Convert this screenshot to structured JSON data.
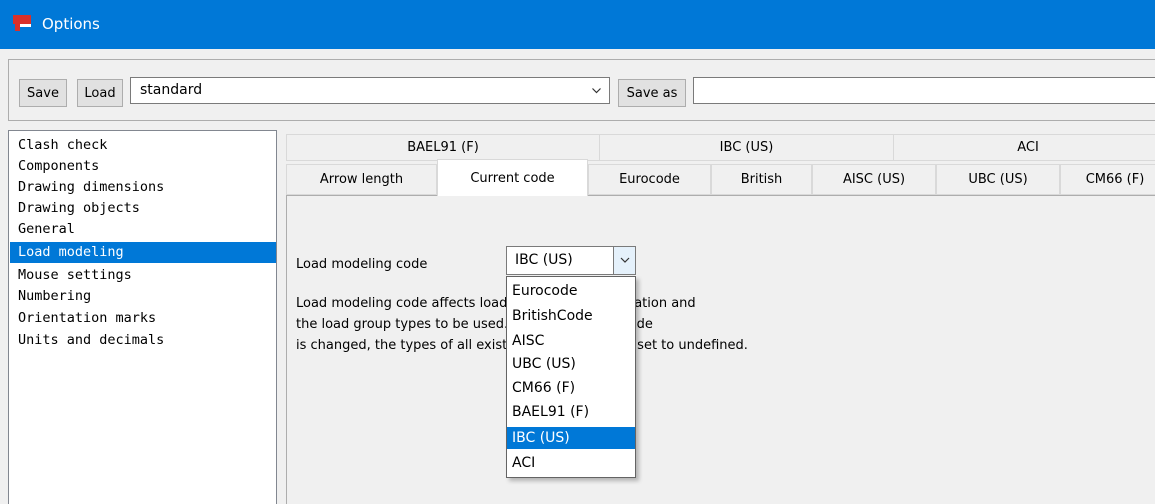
{
  "window": {
    "title": "Options"
  },
  "toolbar": {
    "save_label": "Save",
    "load_label": "Load",
    "profile_value": "standard",
    "saveas_label": "Save as",
    "saveas_value": ""
  },
  "sidebar": {
    "items": [
      "Clash check",
      "Components",
      "Drawing dimensions",
      "Drawing objects",
      "General",
      "Load modeling",
      "Mouse settings",
      "Numbering",
      "Orientation marks",
      "Units and decimals"
    ],
    "selected": "Load modeling"
  },
  "tabs": {
    "row1": [
      "BAEL91 (F)",
      "IBC (US)",
      "ACI"
    ],
    "row2": [
      "Arrow length",
      "Current code",
      "Eurocode",
      "British",
      "AISC (US)",
      "UBC (US)",
      "CM66 (F)"
    ],
    "active": "Current code"
  },
  "main": {
    "code_label": "Load modeling code",
    "code_value": "IBC (US)",
    "description": [
      "Load modeling code affects load combination generation and",
      "the load group types to be used. If load modeling code",
      "is changed, the types of all existing load groups are set to undefined."
    ]
  },
  "dropdown": {
    "options": [
      "Eurocode",
      "BritishCode",
      "AISC",
      "UBC (US)",
      "CM66 (F)",
      "BAEL91 (F)",
      "IBC (US)",
      "ACI"
    ],
    "selected": "IBC (US)"
  },
  "colors": {
    "titlebar": "#0078d7",
    "selection": "#0078d7",
    "window_bg": "#f0f0f0"
  }
}
